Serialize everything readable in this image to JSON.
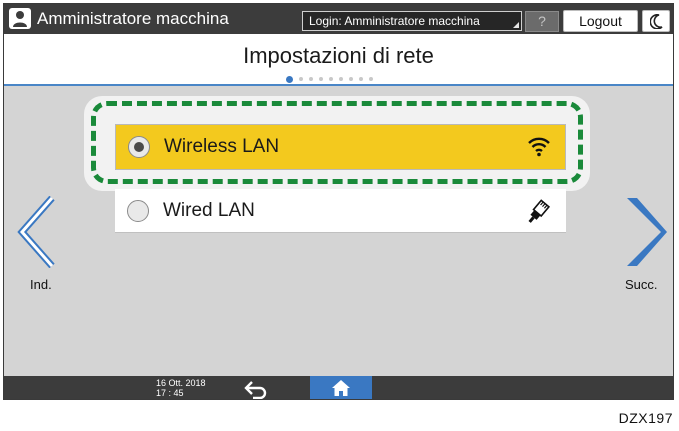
{
  "header": {
    "title": "Amministratore macchina",
    "login_label": "Login: Amministratore macchina",
    "help_label": "?",
    "logout_label": "Logout",
    "icons": [
      "user-icon",
      "moon-icon"
    ]
  },
  "page": {
    "title": "Impostazioni di rete",
    "page_count": 9,
    "current_page": 1
  },
  "options": [
    {
      "label": "Wireless LAN",
      "selected": true,
      "icon": "wifi-icon"
    },
    {
      "label": "Wired LAN",
      "selected": false,
      "icon": "ethernet-icon"
    }
  ],
  "nav": {
    "back_label": "Ind.",
    "next_label": "Succ."
  },
  "footer": {
    "date": "16 Ott. 2018",
    "time": "17 : 45",
    "icons": [
      "back-arrow-icon",
      "home-icon"
    ]
  },
  "caption": "DZX197",
  "colors": {
    "selected_row": "#f3c91e",
    "accent_blue": "#3a78c2",
    "highlight_dash": "#1a8a3a"
  }
}
